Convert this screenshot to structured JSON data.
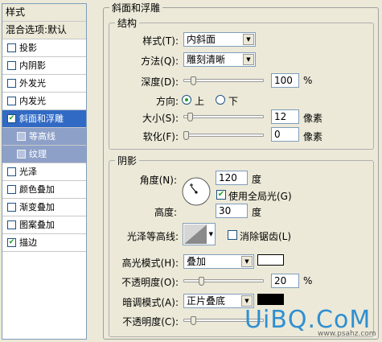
{
  "colors": {
    "selected_row": "#316ac5",
    "highlight_swatch": "#ffffff",
    "shadow_swatch": "#000000",
    "watermark": "#2e8fd1"
  },
  "styles_panel": {
    "title": "样式",
    "blending_options": "混合选项:默认",
    "items": [
      {
        "label": "投影",
        "checked": false
      },
      {
        "label": "内阴影",
        "checked": false
      },
      {
        "label": "外发光",
        "checked": false
      },
      {
        "label": "内发光",
        "checked": false
      },
      {
        "label": "斜面和浮雕",
        "checked": true
      },
      {
        "label": "等高线",
        "checked": false
      },
      {
        "label": "纹理",
        "checked": false
      },
      {
        "label": "光泽",
        "checked": false
      },
      {
        "label": "颜色叠加",
        "checked": false
      },
      {
        "label": "渐变叠加",
        "checked": false
      },
      {
        "label": "图案叠加",
        "checked": false
      },
      {
        "label": "描边",
        "checked": true
      }
    ]
  },
  "bevel": {
    "title": "斜面和浮雕",
    "structure": {
      "title": "结构",
      "style_label": "样式(T):",
      "style_value": "内斜面",
      "technique_label": "方法(Q):",
      "technique_value": "雕刻清晰",
      "depth_label": "深度(D):",
      "depth_value": "100",
      "depth_unit": "%",
      "depth_level": 0.1,
      "direction_label": "方向:",
      "dir_up": "上",
      "dir_down": "下",
      "size_label": "大小(S):",
      "size_value": "12",
      "size_unit": "像素",
      "size_level": 0.05,
      "soften_label": "软化(F):",
      "soften_value": "0",
      "soften_unit": "像素",
      "soften_level": 0
    },
    "shading": {
      "title": "阴影",
      "angle_label": "角度(N):",
      "angle_value": "120",
      "angle_unit": "度",
      "global_light_label": "使用全局光(G)",
      "altitude_label": "高度:",
      "altitude_value": "30",
      "altitude_unit": "度",
      "gloss_contour_label": "光泽等高线:",
      "anti_aliased_label": "消除锯齿(L)",
      "highlight_mode_label": "高光模式(H):",
      "highlight_mode_value": "叠加",
      "highlight_opacity_label": "不透明度(O):",
      "highlight_opacity_value": "20",
      "highlight_opacity_unit": "%",
      "highlight_opacity_level": 0.2,
      "shadow_mode_label": "暗调模式(A):",
      "shadow_mode_value": "正片叠底",
      "shadow_opacity_label": "不透明度(C):",
      "shadow_opacity_level": 0.1
    }
  },
  "watermark": {
    "brand": "UiBQ.CoM",
    "site": "www.psahz.com"
  }
}
